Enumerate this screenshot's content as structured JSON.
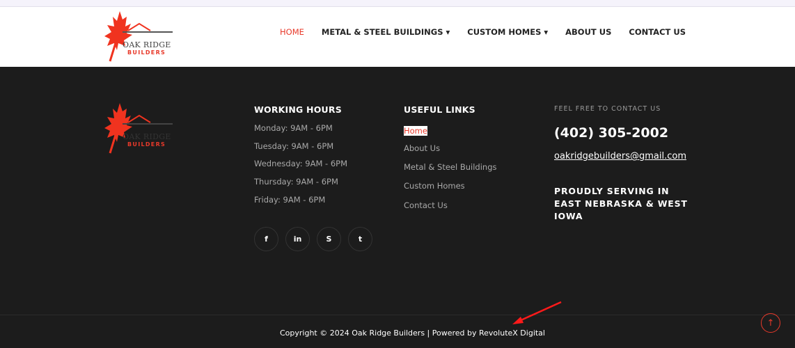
{
  "brand": {
    "name": "OAK RIDGE",
    "sub": "BUILDERS"
  },
  "nav": [
    {
      "label": "HOME"
    },
    {
      "label": "METAL & STEEL BUILDINGS ▾"
    },
    {
      "label": "CUSTOM HOMES ▾"
    },
    {
      "label": "ABOUT US"
    },
    {
      "label": "CONTACT US"
    }
  ],
  "hours": {
    "title": "WORKING HOURS",
    "items": [
      "Monday: 9AM - 6PM",
      "Tuesday: 9AM - 6PM",
      "Wednesday: 9AM - 6PM",
      "Thursday: 9AM - 6PM",
      "Friday: 9AM - 6PM"
    ]
  },
  "social": {
    "facebook": "f",
    "linkedin": "in",
    "skype": "S",
    "twitter": "t"
  },
  "links": {
    "title": "USEFUL LINKS",
    "items": [
      "Home",
      "About Us",
      "Metal & Steel Buildings",
      "Custom Homes",
      "Contact Us"
    ]
  },
  "contact": {
    "label": "FEEL FREE TO CONTACT US",
    "phone": "(402) 305-2002",
    "email": "oakridgebuilders@gmail.com",
    "serving": "PROUDLY SERVING IN EAST NEBRASKA & WEST IOWA"
  },
  "footer": {
    "copyright": "Copyright © 2024 Oak Ridge Builders | Powered by RevoluteX Digital",
    "to_top": "↑"
  },
  "colors": {
    "accent": "#e8392a",
    "footer_bg": "#1c1c1c"
  }
}
